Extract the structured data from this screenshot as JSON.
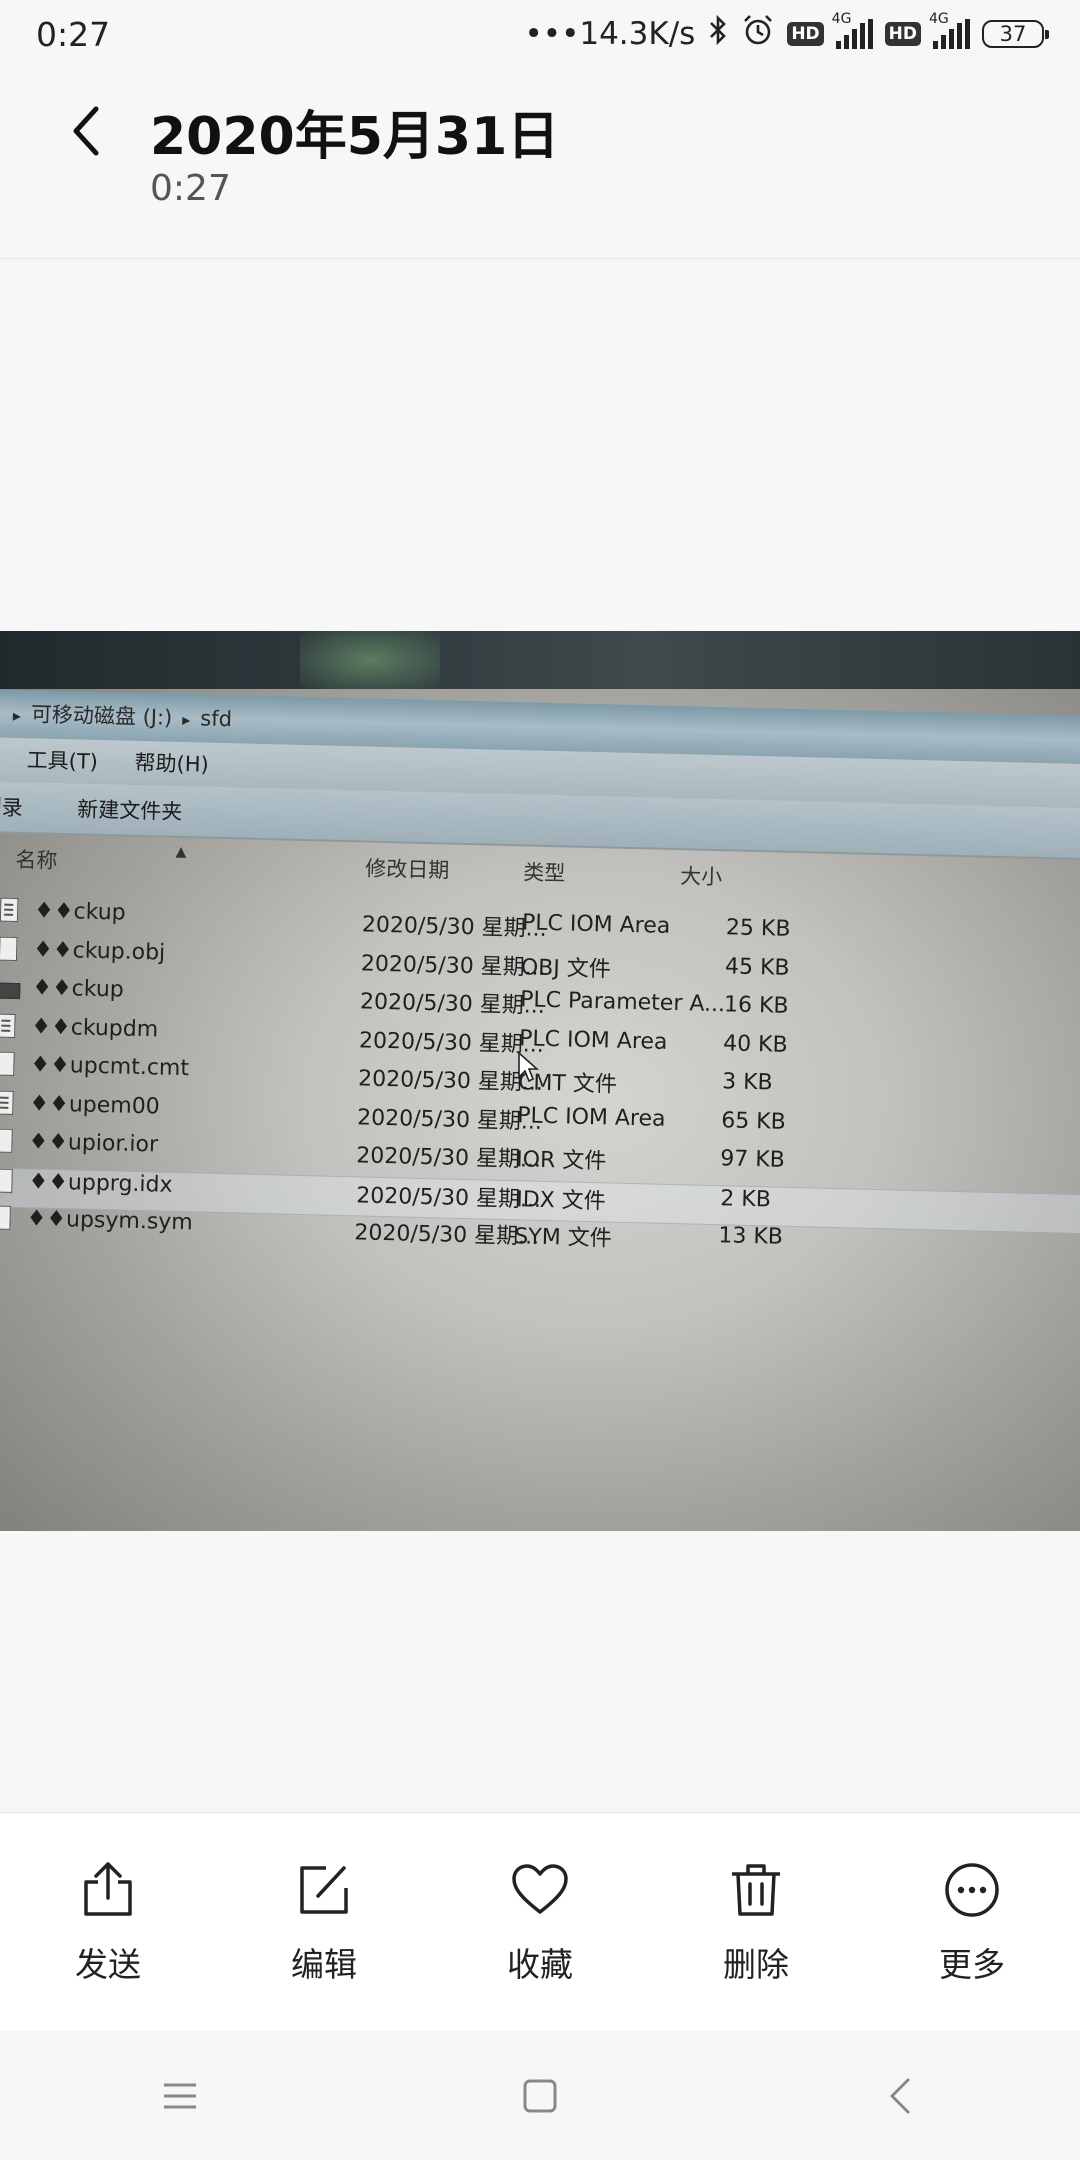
{
  "status_bar": {
    "time": "0:27",
    "net_speed": "•••14.3K/s",
    "hd1": "HD",
    "net1": "4G",
    "hd2": "HD",
    "net2": "4G",
    "battery": "37",
    "icons": [
      "bluetooth-icon",
      "alarm-icon",
      "signal-icon",
      "battery-icon"
    ]
  },
  "header": {
    "title": "2020年5月31日",
    "subtitle": "0:27"
  },
  "photo": {
    "address": [
      "可移动磁盘 (J:)",
      "sfd"
    ],
    "menu": [
      "工具(T)",
      "帮助(H)"
    ],
    "menu_partial": ")",
    "toolbar": [
      "刻录",
      "新建文件夹"
    ],
    "columns": {
      "name": "名称",
      "date": "修改日期",
      "type": "类型",
      "size": "大小"
    },
    "files": [
      {
        "name": "♦♦ckup",
        "date": "2020/5/30 星期...",
        "type": "PLC IOM Area",
        "size": "25 KB",
        "icon": "text-file-icon"
      },
      {
        "name": "♦♦ckup.obj",
        "date": "2020/5/30 星期...",
        "type": "OBJ 文件",
        "size": "45 KB",
        "icon": "file-icon"
      },
      {
        "name": "♦♦ckup",
        "date": "2020/5/30 星期...",
        "type": "PLC Parameter A...",
        "size": "16 KB",
        "icon": "chip-icon"
      },
      {
        "name": "♦♦ckupdm",
        "date": "2020/5/30 星期...",
        "type": "PLC IOM Area",
        "size": "40 KB",
        "icon": "text-file-icon"
      },
      {
        "name": "♦♦upcmt.cmt",
        "date": "2020/5/30 星期...",
        "type": "CMT 文件",
        "size": "3 KB",
        "icon": "file-icon"
      },
      {
        "name": "♦♦upem00",
        "date": "2020/5/30 星期...",
        "type": "PLC IOM Area",
        "size": "65 KB",
        "icon": "text-file-icon"
      },
      {
        "name": "♦♦upior.ior",
        "date": "2020/5/30 星期...",
        "type": "IOR 文件",
        "size": "97 KB",
        "icon": "file-icon"
      },
      {
        "name": "♦♦upprg.idx",
        "date": "2020/5/30 星期...",
        "type": "IDX 文件",
        "size": "2 KB",
        "icon": "file-icon"
      },
      {
        "name": "♦♦upsym.sym",
        "date": "2020/5/30 星期...",
        "type": "SYM 文件",
        "size": "13 KB",
        "icon": "file-icon"
      }
    ]
  },
  "actions": [
    {
      "label": "发送",
      "icon": "share-icon"
    },
    {
      "label": "编辑",
      "icon": "edit-icon"
    },
    {
      "label": "收藏",
      "icon": "heart-icon"
    },
    {
      "label": "删除",
      "icon": "trash-icon"
    },
    {
      "label": "更多",
      "icon": "more-icon"
    }
  ],
  "nav": [
    "menu-icon",
    "home-icon",
    "back-icon"
  ],
  "colors": {
    "background": "#f7f7f7",
    "action_bar": "#ffffff",
    "text": "#111111"
  }
}
